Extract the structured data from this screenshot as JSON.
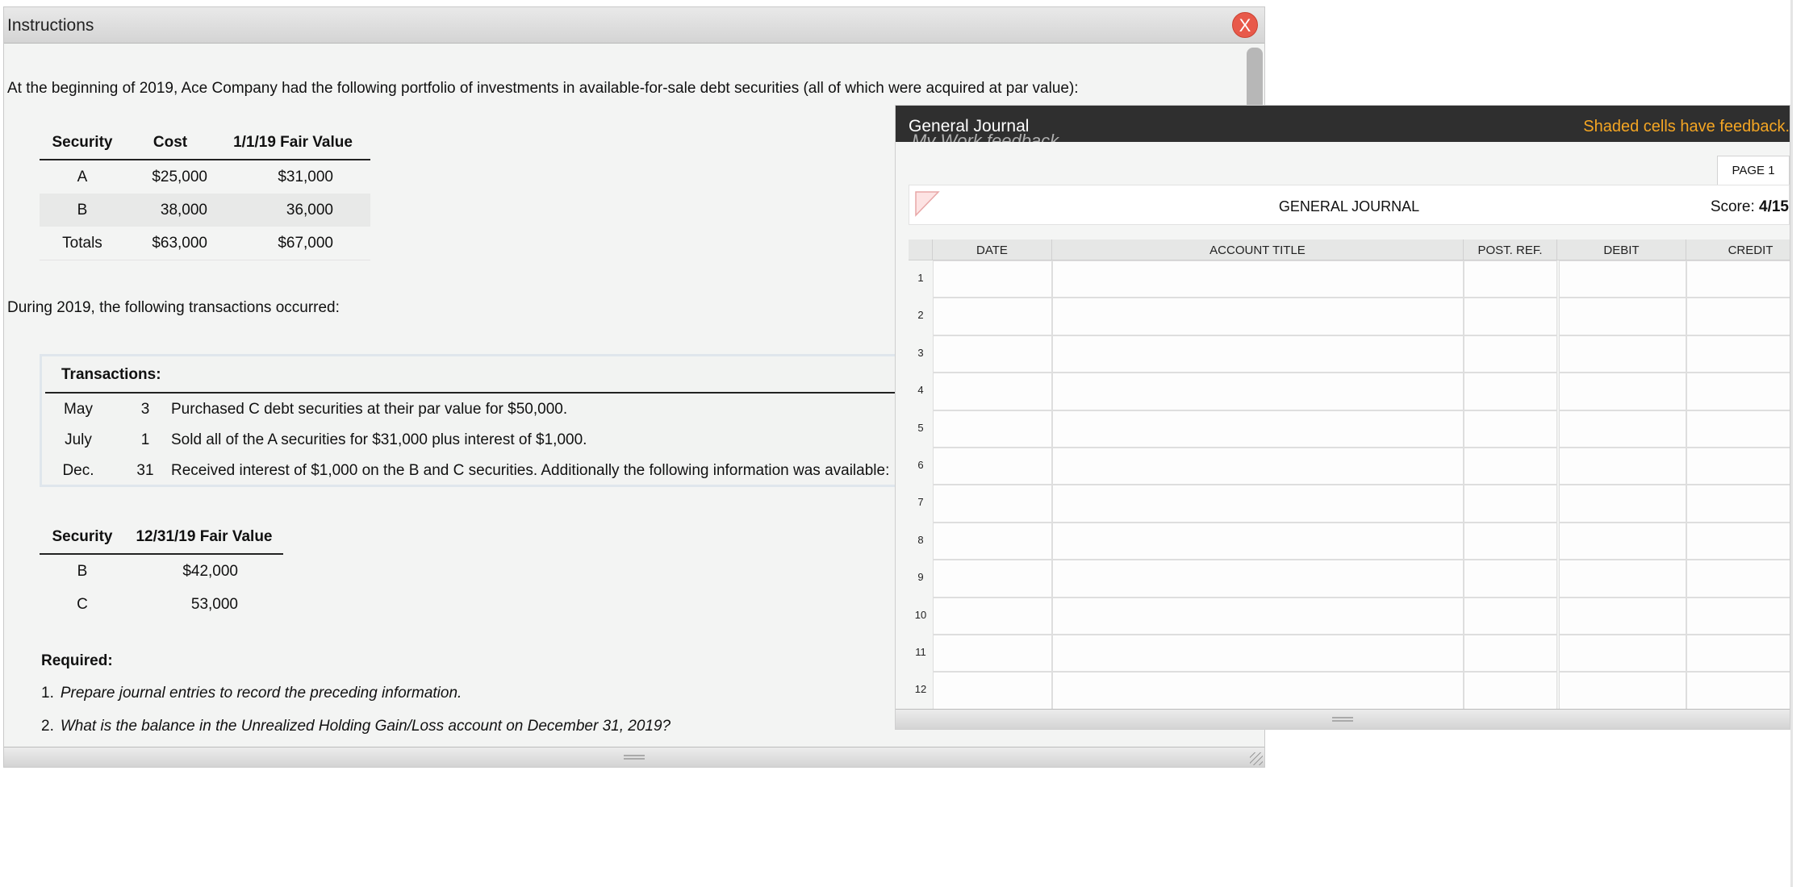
{
  "instructions": {
    "title": "Instructions",
    "close_label": "X",
    "intro": "At the beginning of 2019, Ace Company had the following portfolio of investments in available-for-sale debt securities (all of which were acquired at par value):",
    "portfolio": {
      "headers": [
        "Security",
        "Cost",
        "1/1/19 Fair Value"
      ],
      "rows": [
        [
          "A",
          "$25,000",
          "$31,000"
        ],
        [
          "B",
          "38,000",
          "36,000"
        ],
        [
          "Totals",
          "$63,000",
          "$67,000"
        ]
      ]
    },
    "during": "During 2019, the following transactions occurred:",
    "transactions": {
      "header": "Transactions:",
      "rows": [
        {
          "month": "May",
          "day": "3",
          "text": "Purchased C debt securities at their par value for $50,000."
        },
        {
          "month": "July",
          "day": "1",
          "text": "Sold all of the A securities for $31,000 plus interest of $1,000."
        },
        {
          "month": "Dec.",
          "day": "31",
          "text": "Received interest of $1,000 on the B and C securities. Additionally the following information was available:"
        }
      ]
    },
    "year_end": {
      "headers": [
        "Security",
        "12/31/19 Fair Value"
      ],
      "rows": [
        [
          "B",
          "$42,000"
        ],
        [
          "C",
          "53,000"
        ]
      ]
    },
    "required_label": "Required:",
    "required_items": [
      {
        "num": "1.",
        "text": "Prepare journal entries to record the preceding information."
      },
      {
        "num": "2.",
        "text": "What is the balance in the Unrealized Holding Gain/Loss account on December 31, 2019?"
      }
    ]
  },
  "journal": {
    "title": "General Journal",
    "ghost_text": "My Work feedback.",
    "feedback_notice": "Shaded cells have feedback.",
    "page_tab": "PAGE 1",
    "heading": "GENERAL JOURNAL",
    "score_label": "Score:",
    "score_value": "4/15",
    "columns": [
      "DATE",
      "ACCOUNT TITLE",
      "POST. REF.",
      "DEBIT",
      "CREDIT"
    ],
    "row_numbers": [
      "1",
      "2",
      "3",
      "4",
      "5",
      "6",
      "7",
      "8",
      "9",
      "10",
      "11",
      "12"
    ]
  },
  "colors": {
    "close_button": "#e8594a",
    "feedback_text": "#f5a623",
    "journal_titlebar": "#2f2f2f"
  }
}
